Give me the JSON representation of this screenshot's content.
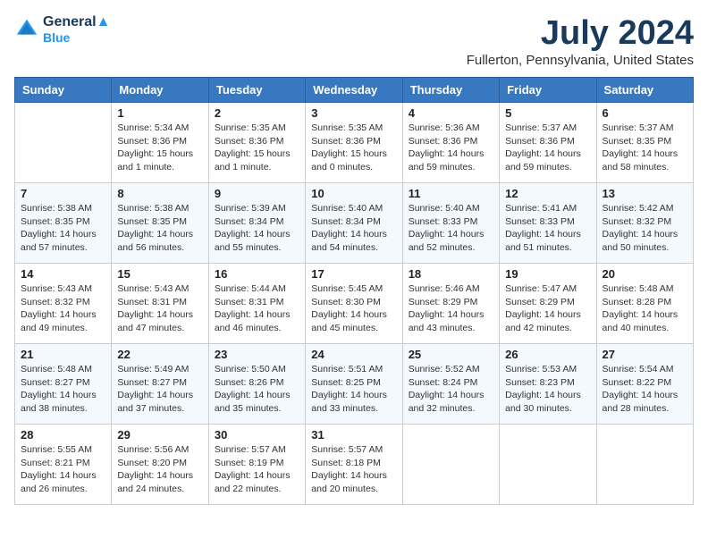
{
  "header": {
    "logo_line1": "General",
    "logo_line2": "Blue",
    "month": "July 2024",
    "location": "Fullerton, Pennsylvania, United States"
  },
  "days_of_week": [
    "Sunday",
    "Monday",
    "Tuesday",
    "Wednesday",
    "Thursday",
    "Friday",
    "Saturday"
  ],
  "weeks": [
    [
      {
        "day": "",
        "info": ""
      },
      {
        "day": "1",
        "info": "Sunrise: 5:34 AM\nSunset: 8:36 PM\nDaylight: 15 hours\nand 1 minute."
      },
      {
        "day": "2",
        "info": "Sunrise: 5:35 AM\nSunset: 8:36 PM\nDaylight: 15 hours\nand 1 minute."
      },
      {
        "day": "3",
        "info": "Sunrise: 5:35 AM\nSunset: 8:36 PM\nDaylight: 15 hours\nand 0 minutes."
      },
      {
        "day": "4",
        "info": "Sunrise: 5:36 AM\nSunset: 8:36 PM\nDaylight: 14 hours\nand 59 minutes."
      },
      {
        "day": "5",
        "info": "Sunrise: 5:37 AM\nSunset: 8:36 PM\nDaylight: 14 hours\nand 59 minutes."
      },
      {
        "day": "6",
        "info": "Sunrise: 5:37 AM\nSunset: 8:35 PM\nDaylight: 14 hours\nand 58 minutes."
      }
    ],
    [
      {
        "day": "7",
        "info": "Sunrise: 5:38 AM\nSunset: 8:35 PM\nDaylight: 14 hours\nand 57 minutes."
      },
      {
        "day": "8",
        "info": "Sunrise: 5:38 AM\nSunset: 8:35 PM\nDaylight: 14 hours\nand 56 minutes."
      },
      {
        "day": "9",
        "info": "Sunrise: 5:39 AM\nSunset: 8:34 PM\nDaylight: 14 hours\nand 55 minutes."
      },
      {
        "day": "10",
        "info": "Sunrise: 5:40 AM\nSunset: 8:34 PM\nDaylight: 14 hours\nand 54 minutes."
      },
      {
        "day": "11",
        "info": "Sunrise: 5:40 AM\nSunset: 8:33 PM\nDaylight: 14 hours\nand 52 minutes."
      },
      {
        "day": "12",
        "info": "Sunrise: 5:41 AM\nSunset: 8:33 PM\nDaylight: 14 hours\nand 51 minutes."
      },
      {
        "day": "13",
        "info": "Sunrise: 5:42 AM\nSunset: 8:32 PM\nDaylight: 14 hours\nand 50 minutes."
      }
    ],
    [
      {
        "day": "14",
        "info": "Sunrise: 5:43 AM\nSunset: 8:32 PM\nDaylight: 14 hours\nand 49 minutes."
      },
      {
        "day": "15",
        "info": "Sunrise: 5:43 AM\nSunset: 8:31 PM\nDaylight: 14 hours\nand 47 minutes."
      },
      {
        "day": "16",
        "info": "Sunrise: 5:44 AM\nSunset: 8:31 PM\nDaylight: 14 hours\nand 46 minutes."
      },
      {
        "day": "17",
        "info": "Sunrise: 5:45 AM\nSunset: 8:30 PM\nDaylight: 14 hours\nand 45 minutes."
      },
      {
        "day": "18",
        "info": "Sunrise: 5:46 AM\nSunset: 8:29 PM\nDaylight: 14 hours\nand 43 minutes."
      },
      {
        "day": "19",
        "info": "Sunrise: 5:47 AM\nSunset: 8:29 PM\nDaylight: 14 hours\nand 42 minutes."
      },
      {
        "day": "20",
        "info": "Sunrise: 5:48 AM\nSunset: 8:28 PM\nDaylight: 14 hours\nand 40 minutes."
      }
    ],
    [
      {
        "day": "21",
        "info": "Sunrise: 5:48 AM\nSunset: 8:27 PM\nDaylight: 14 hours\nand 38 minutes."
      },
      {
        "day": "22",
        "info": "Sunrise: 5:49 AM\nSunset: 8:27 PM\nDaylight: 14 hours\nand 37 minutes."
      },
      {
        "day": "23",
        "info": "Sunrise: 5:50 AM\nSunset: 8:26 PM\nDaylight: 14 hours\nand 35 minutes."
      },
      {
        "day": "24",
        "info": "Sunrise: 5:51 AM\nSunset: 8:25 PM\nDaylight: 14 hours\nand 33 minutes."
      },
      {
        "day": "25",
        "info": "Sunrise: 5:52 AM\nSunset: 8:24 PM\nDaylight: 14 hours\nand 32 minutes."
      },
      {
        "day": "26",
        "info": "Sunrise: 5:53 AM\nSunset: 8:23 PM\nDaylight: 14 hours\nand 30 minutes."
      },
      {
        "day": "27",
        "info": "Sunrise: 5:54 AM\nSunset: 8:22 PM\nDaylight: 14 hours\nand 28 minutes."
      }
    ],
    [
      {
        "day": "28",
        "info": "Sunrise: 5:55 AM\nSunset: 8:21 PM\nDaylight: 14 hours\nand 26 minutes."
      },
      {
        "day": "29",
        "info": "Sunrise: 5:56 AM\nSunset: 8:20 PM\nDaylight: 14 hours\nand 24 minutes."
      },
      {
        "day": "30",
        "info": "Sunrise: 5:57 AM\nSunset: 8:19 PM\nDaylight: 14 hours\nand 22 minutes."
      },
      {
        "day": "31",
        "info": "Sunrise: 5:57 AM\nSunset: 8:18 PM\nDaylight: 14 hours\nand 20 minutes."
      },
      {
        "day": "",
        "info": ""
      },
      {
        "day": "",
        "info": ""
      },
      {
        "day": "",
        "info": ""
      }
    ]
  ]
}
